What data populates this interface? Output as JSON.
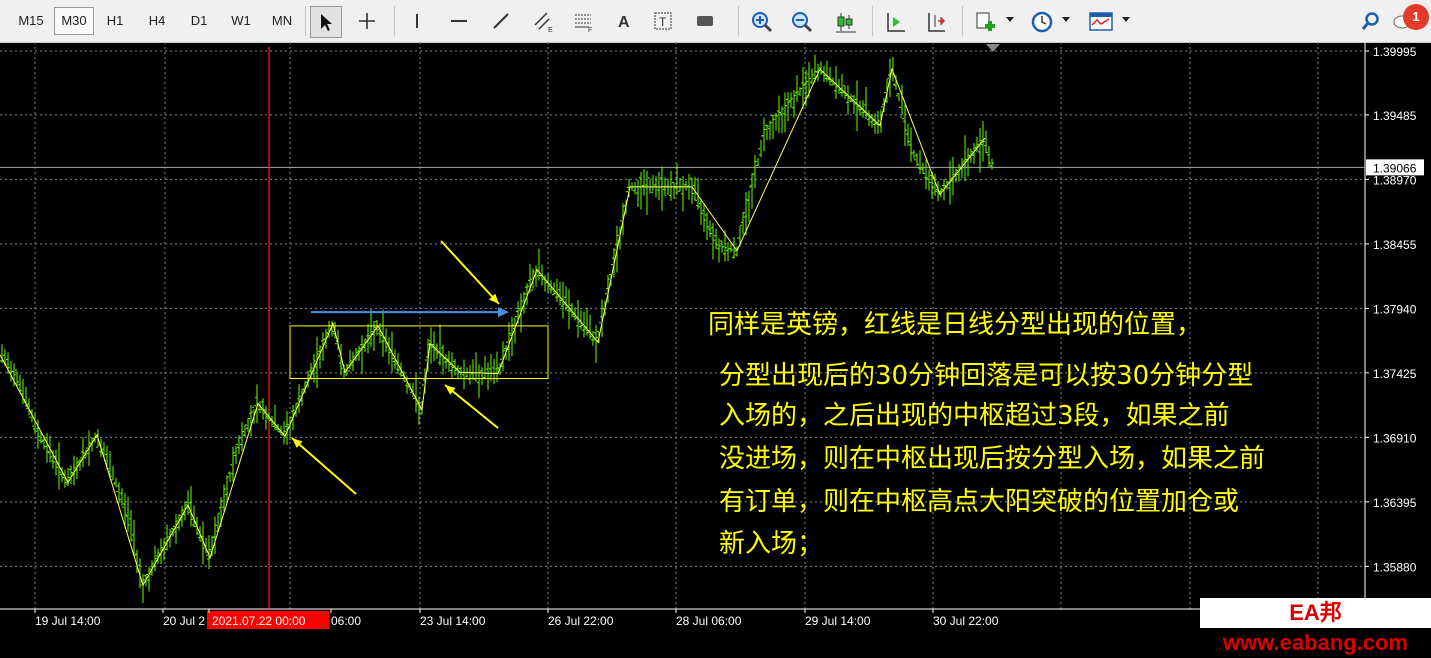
{
  "toolbar": {
    "timeframes": [
      "M15",
      "M30",
      "H1",
      "H4",
      "D1",
      "W1",
      "MN"
    ],
    "active_timeframe": "M30",
    "notification_count": "1",
    "icons": [
      "cursor-icon",
      "crosshair-icon",
      "vertical-line-icon",
      "horizontal-line-icon",
      "trendline-icon",
      "equidistant-channel-icon",
      "fibonacci-icon",
      "text-icon",
      "text-label-icon",
      "rectangle-label-icon",
      "zoom-in-icon",
      "zoom-out-icon",
      "candlestick-icon",
      "chart-shift-icon",
      "autoscroll-icon",
      "new-order-icon",
      "clock-icon",
      "templates-icon",
      "search-icon",
      "chat-icon"
    ]
  },
  "chart_data": {
    "type": "bar",
    "style": "OHLC bars",
    "symbol_note": "GBP pound chart, M30",
    "current_price": "1.39066",
    "price_ticks": [
      "1.39995",
      "1.39485",
      "1.38970",
      "1.38455",
      "1.37940",
      "1.37425",
      "1.36910",
      "1.36395",
      "1.35880"
    ],
    "ylim": [
      1.356,
      1.4025
    ],
    "time_labels": [
      "19 Jul 14:00",
      "20 Jul 2",
      "2021.07.22 00:00",
      "06:00",
      "23 Jul 14:00",
      "26 Jul 22:00",
      "28 Jul 06:00",
      "29 Jul 14:00",
      "30 Jul 22:00"
    ],
    "highlighted_time": "2021.07.22 00:00",
    "price_path_key": [
      [
        0,
        1.3757
      ],
      [
        18,
        1.374
      ],
      [
        35,
        1.37
      ],
      [
        68,
        1.3655
      ],
      [
        97,
        1.3693
      ],
      [
        130,
        1.3625
      ],
      [
        143,
        1.3573
      ],
      [
        188,
        1.3637
      ],
      [
        210,
        1.3595
      ],
      [
        237,
        1.3682
      ],
      [
        258,
        1.3718
      ],
      [
        285,
        1.3692
      ],
      [
        333,
        1.3782
      ],
      [
        345,
        1.3743
      ],
      [
        378,
        1.378
      ],
      [
        422,
        1.3713
      ],
      [
        430,
        1.3766
      ],
      [
        460,
        1.3743
      ],
      [
        498,
        1.3742
      ],
      [
        520,
        1.3792
      ],
      [
        537,
        1.3825
      ],
      [
        598,
        1.3767
      ],
      [
        630,
        1.3891
      ],
      [
        692,
        1.3891
      ],
      [
        718,
        1.3845
      ],
      [
        737,
        1.384
      ],
      [
        765,
        1.3935
      ],
      [
        820,
        1.3985
      ],
      [
        880,
        1.394
      ],
      [
        892,
        1.3985
      ],
      [
        915,
        1.3915
      ],
      [
        940,
        1.3885
      ],
      [
        985,
        1.393
      ],
      [
        992,
        1.391
      ]
    ],
    "zigzag_key": [
      [
        0,
        1.3757
      ],
      [
        68,
        1.3655
      ],
      [
        97,
        1.3693
      ],
      [
        143,
        1.3573
      ],
      [
        188,
        1.3637
      ],
      [
        210,
        1.3595
      ],
      [
        258,
        1.3718
      ],
      [
        285,
        1.3692
      ],
      [
        333,
        1.3782
      ],
      [
        345,
        1.3743
      ],
      [
        378,
        1.378
      ],
      [
        422,
        1.3713
      ],
      [
        430,
        1.3766
      ],
      [
        460,
        1.3743
      ],
      [
        498,
        1.3742
      ],
      [
        537,
        1.3825
      ],
      [
        598,
        1.3767
      ],
      [
        630,
        1.3891
      ],
      [
        692,
        1.3891
      ],
      [
        737,
        1.384
      ],
      [
        820,
        1.3985
      ],
      [
        880,
        1.394
      ],
      [
        892,
        1.3985
      ],
      [
        940,
        1.3885
      ],
      [
        985,
        1.393
      ]
    ],
    "zone_box": {
      "x0_time_pos": 290,
      "x1_time_pos": 548,
      "top": 1.378,
      "bottom": 1.3738
    },
    "colors": {
      "bars": "#66ff00",
      "zigzag": "#ffff66",
      "grid": "#7a8a9a",
      "axis_text": "#ffffff",
      "vline": "#ff2020",
      "blue_arrow": "#4a90e2",
      "yellow_arrow": "#ffff00",
      "box": "#ffff00",
      "label_bg": "#ff0000"
    }
  },
  "annotation": {
    "lines": [
      "同样是英镑，红线是日线分型出现的位置，",
      "分型出现后的30分钟回落是可以按30分钟分型",
      "入场的，之后出现的中枢超过3段，如果之前",
      "没进场，则在中枢出现后按分型入场，如果之前",
      "有订单，则在中枢高点大阳突破的位置加仓或",
      "新入场；"
    ]
  },
  "watermark": {
    "text": "EA邦 www.eabang.com"
  }
}
